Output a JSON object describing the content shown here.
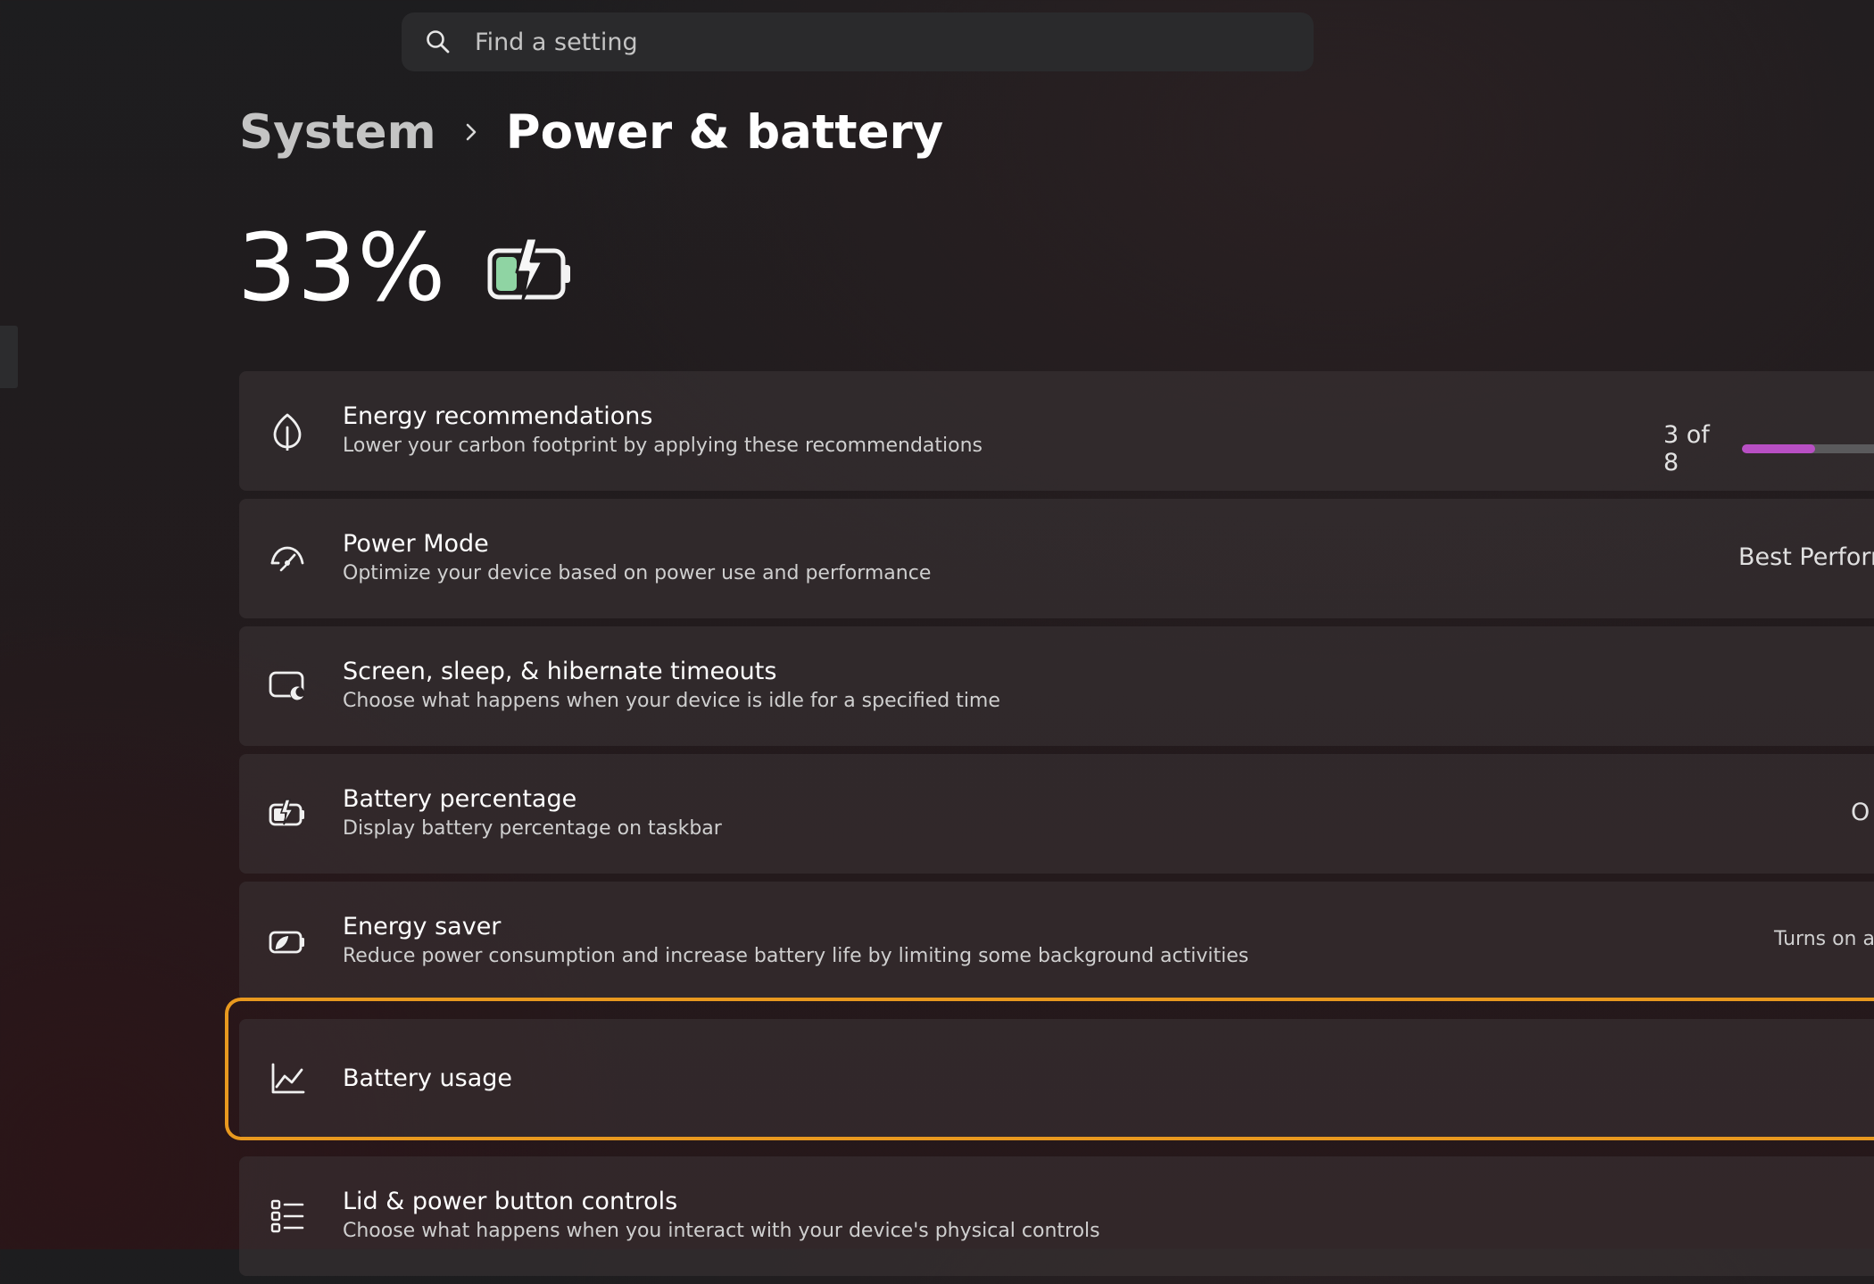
{
  "search": {
    "placeholder": "Find a setting"
  },
  "breadcrumb": {
    "parent": "System",
    "separator": "›",
    "current": "Power & battery"
  },
  "battery": {
    "percent_label": "33%",
    "charge_level": 0.33,
    "charging": true,
    "icon": "battery-charging-icon"
  },
  "colors": {
    "accent_progress": "#b84fc4",
    "focus_ring": "#e8991f",
    "battery_fill": "#8fd4a3"
  },
  "settings": [
    {
      "icon": "leaf-icon",
      "title": "Energy recommendations",
      "subtitle": "Lower your carbon footprint by applying these recommendations",
      "right_text": "3 of 8",
      "progress": 0.375
    },
    {
      "icon": "speedometer-icon",
      "title": "Power Mode",
      "subtitle": "Optimize your device based on power use and performance",
      "right_text": "Best Perform"
    },
    {
      "icon": "screen-sleep-icon",
      "title": "Screen, sleep, & hibernate timeouts",
      "subtitle": "Choose what happens when your device is idle for a specified time"
    },
    {
      "icon": "battery-percentage-icon",
      "title": "Battery percentage",
      "subtitle": "Display battery percentage on taskbar",
      "right_text": "O"
    },
    {
      "icon": "energy-saver-icon",
      "title": "Energy saver",
      "subtitle": "Reduce power consumption and increase battery life by limiting some background activities",
      "right_text": "Turns on a"
    },
    {
      "icon": "chart-line-icon",
      "title": "Battery usage",
      "focused": true
    },
    {
      "icon": "list-settings-icon",
      "title": "Lid & power button controls",
      "subtitle": "Choose what happens when you interact with your device's physical controls"
    }
  ]
}
